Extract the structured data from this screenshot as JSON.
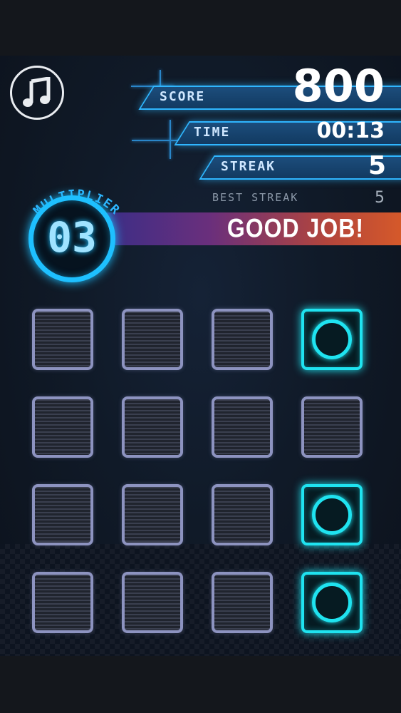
{
  "hud": {
    "score_label": "SCORE",
    "score_value": "800",
    "time_label": "TIME",
    "time_value": "00:13",
    "streak_label": "STREAK",
    "streak_value": "5",
    "best_streak_label": "BEST STREAK",
    "best_streak_value": "5"
  },
  "multiplier": {
    "label": "MULTIPLIER",
    "value": "03"
  },
  "banner": {
    "text": "GOOD JOB!"
  },
  "music_button": {
    "icon": "music-note-icon"
  },
  "board": {
    "rows": [
      [
        false,
        false,
        false,
        true
      ],
      [
        false,
        false,
        false,
        false
      ],
      [
        false,
        false,
        false,
        true
      ],
      [
        false,
        false,
        false,
        true
      ]
    ]
  },
  "colors": {
    "accent_blue": "#2fb6ff",
    "active_tile": "#1fe3f0",
    "inactive_tile_border": "#8d93c0",
    "banner_start": "#3c2e86",
    "banner_end": "#d5592a"
  }
}
